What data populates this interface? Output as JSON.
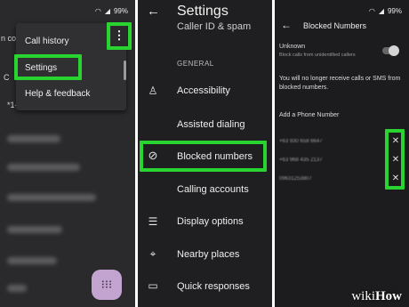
{
  "colors": {
    "highlight": "#29d330",
    "fab": "#c3a3cf"
  },
  "status": {
    "battery": "99%"
  },
  "panel1": {
    "fragment_top": "n co",
    "fragment_a": "C",
    "fragment_b": "*1-",
    "menu": {
      "items": [
        {
          "label": "Call history"
        },
        {
          "label": "Settings"
        },
        {
          "label": "Help & feedback"
        }
      ]
    },
    "kebab_icon": "more-vertical-icon",
    "fab_icon": "dialpad-icon"
  },
  "panel2": {
    "title": "Settings",
    "partial_item": "Caller ID & spam",
    "section_header": "GENERAL",
    "items": [
      {
        "label": "Accessibility",
        "icon": "accessibility-icon"
      },
      {
        "label": "Assisted dialing",
        "icon": ""
      },
      {
        "label": "Blocked numbers",
        "icon": "block-icon"
      },
      {
        "label": "Calling accounts",
        "icon": ""
      },
      {
        "label": "Display options",
        "icon": "list-icon"
      },
      {
        "label": "Nearby places",
        "icon": "location-icon"
      },
      {
        "label": "Quick responses",
        "icon": "message-icon"
      }
    ]
  },
  "panel3": {
    "title": "Blocked Numbers",
    "unknown_label": "Unknown",
    "unknown_sub": "Block calls from unidentified callers",
    "notice": "You will no longer receive calls or SMS from blocked numbers.",
    "add_label": "Add a Phone Number",
    "numbers": [
      "+63 930 658 6647",
      "+63 968 435 2137",
      "09631253807"
    ]
  },
  "watermark": {
    "prefix": "wiki",
    "suffix": "How"
  }
}
